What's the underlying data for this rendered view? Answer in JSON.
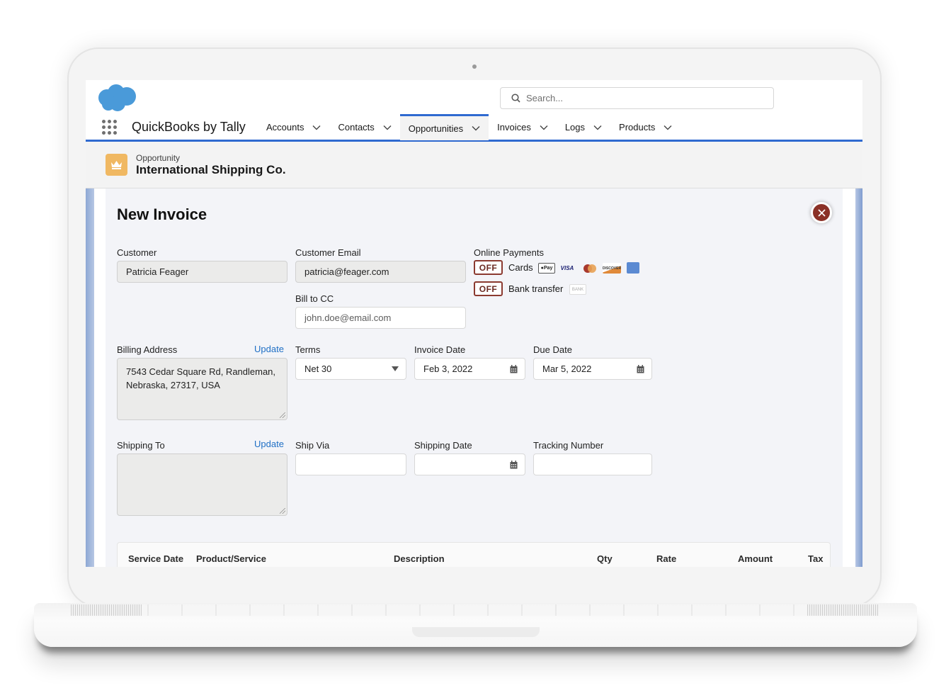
{
  "app": {
    "name": "QuickBooks by Tally",
    "search_placeholder": "Search..."
  },
  "nav": {
    "items": [
      {
        "label": "Accounts",
        "active": false
      },
      {
        "label": "Contacts",
        "active": false
      },
      {
        "label": "Opportunities",
        "active": true
      },
      {
        "label": "Invoices",
        "active": false
      },
      {
        "label": "Logs",
        "active": false
      },
      {
        "label": "Products",
        "active": false
      }
    ]
  },
  "record": {
    "type": "Opportunity",
    "name": "International Shipping Co.",
    "icon": "crown-icon"
  },
  "modal": {
    "title": "New Invoice",
    "close_icon": "close-icon"
  },
  "form": {
    "customer": {
      "label": "Customer",
      "value": "Patricia Feager"
    },
    "customer_email": {
      "label": "Customer Email",
      "value": "patricia@feager.com"
    },
    "bill_to_cc": {
      "label": "Bill to CC",
      "placeholder": "john.doe@email.com"
    },
    "online_payments": {
      "label": "Online Payments",
      "cards": {
        "toggle": "OFF",
        "label": "Cards",
        "badges": [
          "Apple Pay",
          "VISA",
          "Mastercard",
          "DISCOVER",
          "American Express"
        ]
      },
      "bank": {
        "toggle": "OFF",
        "label": "Bank transfer",
        "badge": "BANK"
      }
    },
    "billing_address": {
      "label": "Billing Address",
      "link": "Update",
      "value": "7543 Cedar Square Rd, Randleman, Nebraska, 27317, USA"
    },
    "terms": {
      "label": "Terms",
      "value": "Net 30"
    },
    "invoice_date": {
      "label": "Invoice Date",
      "value": "Feb 3, 2022"
    },
    "due_date": {
      "label": "Due Date",
      "value": "Mar 5, 2022"
    },
    "shipping_to": {
      "label": "Shipping To",
      "link": "Update",
      "value": ""
    },
    "ship_via": {
      "label": "Ship Via",
      "value": ""
    },
    "shipping_date": {
      "label": "Shipping Date",
      "value": ""
    },
    "tracking_number": {
      "label": "Tracking Number",
      "value": ""
    }
  },
  "line_items": {
    "columns": [
      "Service Date",
      "Product/Service",
      "Description",
      "Qty",
      "Rate",
      "Amount",
      "Tax"
    ]
  },
  "colors": {
    "brand_blue": "#2f6ad0",
    "cloud_blue": "#4a9ad9",
    "record_icon": "#f0b862",
    "toggle_off": "#8b3a30",
    "close_button": "#8b3127",
    "link": "#1f6fc5"
  }
}
